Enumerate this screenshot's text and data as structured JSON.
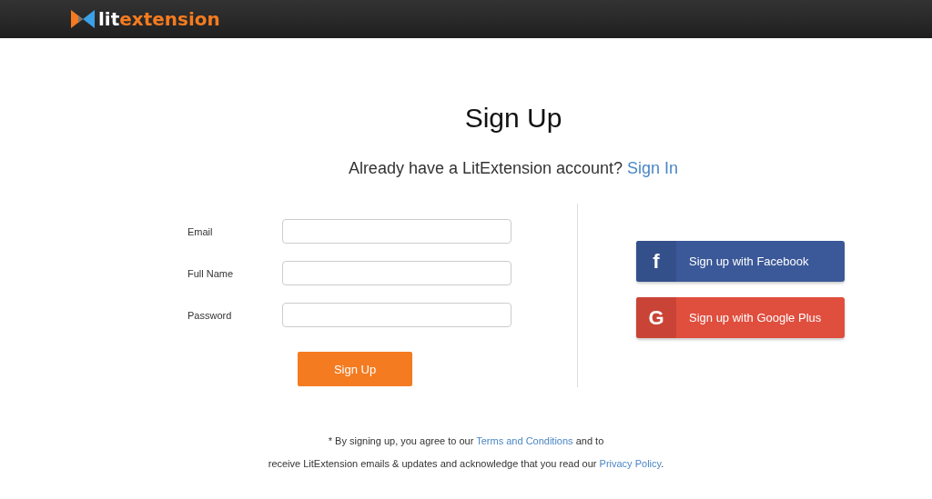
{
  "header": {
    "logo": {
      "part_1": "lit",
      "part_2": "extension"
    }
  },
  "title": "Sign Up",
  "subtitle": {
    "text": "Already have a LitExtension account?",
    "link": "Sign In"
  },
  "form": {
    "fields": [
      {
        "label": "Email"
      },
      {
        "label": "Full Name"
      },
      {
        "label": "Password"
      }
    ],
    "submit": "Sign Up"
  },
  "social": [
    {
      "kind": "facebook",
      "icon": "f",
      "label": "Sign up with Facebook"
    },
    {
      "kind": "google",
      "icon": "G",
      "label": "Sign up with Google Plus"
    }
  ],
  "footer": {
    "line_1": {
      "before": "* By signing up, you agree to our",
      "link": "Terms and Conditions",
      "after": "and to"
    },
    "line_2": {
      "before": "receive LitExtension emails & updates and acknowledge that you read our",
      "link": "Privacy Policy",
      "after": "."
    }
  }
}
